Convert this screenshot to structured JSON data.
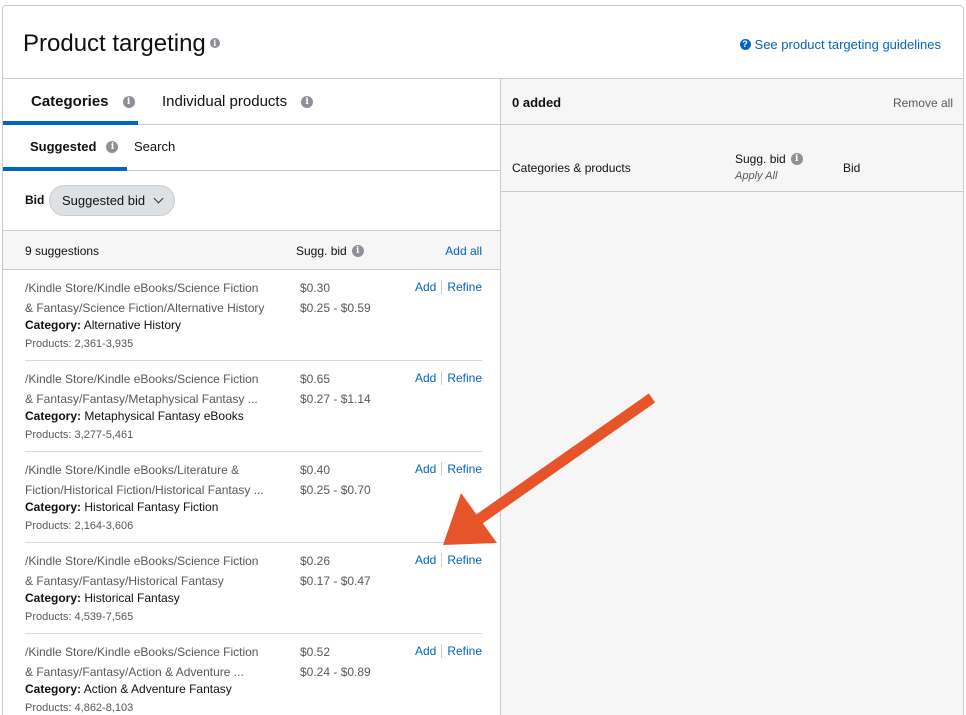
{
  "header": {
    "title": "Product targeting",
    "info_glyph": "i",
    "guide_icon_glyph": "?",
    "guide_link": "See product targeting guidelines"
  },
  "left": {
    "tabs": [
      {
        "label": "Categories",
        "active": true
      },
      {
        "label": "Individual products",
        "active": false
      }
    ],
    "subtabs": [
      {
        "label": "Suggested",
        "active": true
      },
      {
        "label": "Search",
        "active": false
      }
    ],
    "bid": {
      "label": "Bid",
      "selected": "Suggested bid"
    },
    "list_header": {
      "count": "9 suggestions",
      "sugg_bid": "Sugg. bid",
      "add_all": "Add all"
    },
    "rows": [
      {
        "path1": "/Kindle Store/Kindle eBooks/Science Fiction",
        "path2": "& Fantasy/Science Fiction/Alternative History",
        "cat_key": "Category:",
        "cat_val": "Alternative History",
        "products": "Products: 2,361-3,935",
        "bid": "$0.30",
        "range": "$0.25 - $0.59"
      },
      {
        "path1": "/Kindle Store/Kindle eBooks/Science Fiction",
        "path2": "& Fantasy/Fantasy/Metaphysical Fantasy ...",
        "cat_key": "Category:",
        "cat_val": "Metaphysical Fantasy eBooks",
        "products": "Products: 3,277-5,461",
        "bid": "$0.65",
        "range": "$0.27 - $1.14"
      },
      {
        "path1": "/Kindle Store/Kindle eBooks/Literature &",
        "path2": "Fiction/Historical Fiction/Historical Fantasy ...",
        "cat_key": "Category:",
        "cat_val": "Historical Fantasy Fiction",
        "products": "Products: 2,164-3,606",
        "bid": "$0.40",
        "range": "$0.25 - $0.70"
      },
      {
        "path1": "/Kindle Store/Kindle eBooks/Science Fiction",
        "path2": "& Fantasy/Fantasy/Historical Fantasy",
        "cat_key": "Category:",
        "cat_val": "Historical Fantasy",
        "products": "Products: 4,539-7,565",
        "bid": "$0.26",
        "range": "$0.17 - $0.47"
      },
      {
        "path1": "/Kindle Store/Kindle eBooks/Science Fiction",
        "path2": "& Fantasy/Fantasy/Action & Adventure ...",
        "cat_key": "Category:",
        "cat_val": "Action & Adventure Fantasy",
        "products": "Products: 4,862-8,103",
        "bid": "$0.52",
        "range": "$0.24 - $0.89"
      }
    ],
    "row_actions": {
      "add": "Add",
      "refine": "Refine"
    }
  },
  "right": {
    "added": "0 added",
    "remove_all": "Remove all",
    "col_categories": "Categories & products",
    "col_sugg_bid": "Sugg. bid",
    "apply_all": "Apply All",
    "col_bid": "Bid"
  },
  "colors": {
    "link": "#0066c0",
    "arrow": "#e8542a",
    "tab_underline": "#0066c0"
  }
}
